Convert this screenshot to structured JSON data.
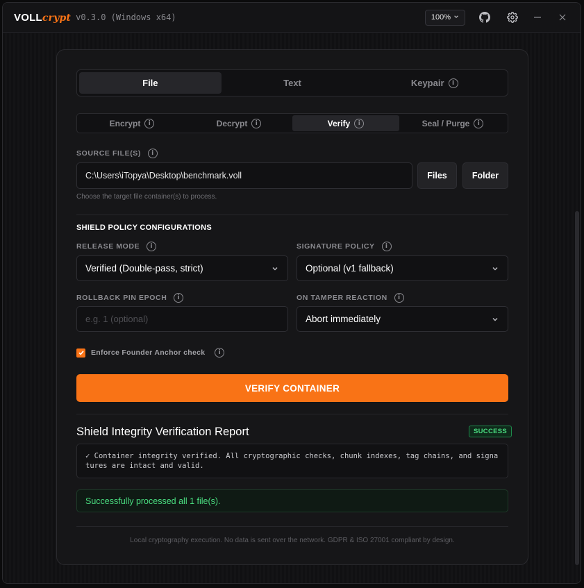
{
  "app": {
    "brand_main": "VOLL",
    "brand_accent": "crypt",
    "version": "v0.3.0 (Windows x64)",
    "zoom": "100%"
  },
  "icons": {
    "zoom_dropdown": "chevron-down-icon",
    "github": "github-icon",
    "settings": "gear-icon",
    "minimize": "minimize-icon",
    "close": "close-icon",
    "info": "info-icon"
  },
  "main_tabs": [
    {
      "label": "File",
      "active": true
    },
    {
      "label": "Text",
      "active": false
    },
    {
      "label": "Keypair",
      "active": false
    }
  ],
  "sub_tabs": [
    {
      "label": "Encrypt",
      "active": false
    },
    {
      "label": "Decrypt",
      "active": false
    },
    {
      "label": "Verify",
      "active": true
    },
    {
      "label": "Seal / Purge",
      "active": false
    }
  ],
  "source": {
    "label": "SOURCE FILE(S)",
    "value": "C:\\Users\\iTopya\\Desktop\\benchmark.voll",
    "files_button": "Files",
    "folder_button": "Folder",
    "hint": "Choose the target file container(s) to process."
  },
  "policy": {
    "heading": "SHIELD POLICY CONFIGURATIONS",
    "release_mode_label": "RELEASE MODE",
    "release_mode_value": "Verified (Double-pass, strict)",
    "signature_policy_label": "SIGNATURE POLICY",
    "signature_policy_value": "Optional (v1 fallback)",
    "rollback_label": "ROLLBACK PIN EPOCH",
    "rollback_placeholder": "e.g. 1 (optional)",
    "tamper_label": "ON TAMPER REACTION",
    "tamper_value": "Abort immediately",
    "founder_check_label": "Enforce Founder Anchor check",
    "founder_check_checked": true
  },
  "action": {
    "verify_button": "VERIFY CONTAINER"
  },
  "report": {
    "title": "Shield Integrity Verification Report",
    "badge": "SUCCESS",
    "output": "✓ Container integrity verified. All cryptographic checks, chunk indexes, tag chains, and signatures are intact and valid.",
    "status": "Successfully processed all 1 file(s)."
  },
  "footer": "Local cryptography execution. No data is sent over the network. GDPR & ISO 27001 compliant by design.",
  "colors": {
    "accent": "#f97316",
    "success": "#4ade80",
    "background": "#121214"
  }
}
